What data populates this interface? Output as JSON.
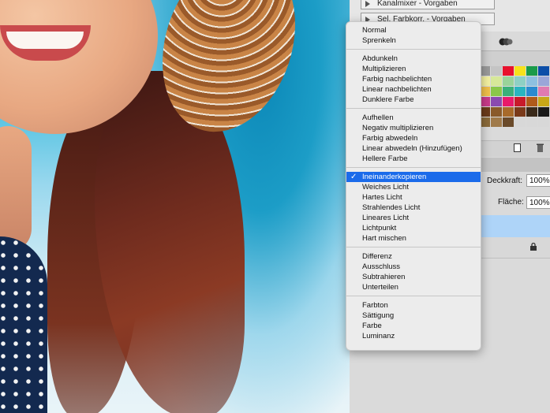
{
  "panel": {
    "adjustments": [
      "Kanalmixer - Vorgaben",
      "Sel. Farbkorr. - Vorgaben"
    ],
    "opacity_label": "Deckkraft:",
    "opacity_value": "100%",
    "fill_label": "Fläche:",
    "fill_value": "100%",
    "swatch_colors": [
      "#9a9a9a",
      "#c4c4c4",
      "#e8112d",
      "#f7e21a",
      "#1a9b4a",
      "#0c4ea8",
      "#f3f0a0",
      "#d7e89a",
      "#9ad39a",
      "#8ed0c4",
      "#8ec0e0",
      "#9aa6d8",
      "#f0c04a",
      "#8ac84a",
      "#3ab07a",
      "#2ab4c0",
      "#2a8ad0",
      "#e07ab0",
      "#c83a8a",
      "#8a4ab0",
      "#e81a6a",
      "#c81a2a",
      "#b05a1a",
      "#c8a818",
      "#6a3a1a",
      "#8a5a2a",
      "#a86a2a",
      "#7a3a1a",
      "#3a2a1a",
      "#1a1a1a",
      "#8a6a3a",
      "#a07a4a",
      "#6a4a2a",
      "#d8d8d8",
      "#d8d8d8",
      "#d8d8d8"
    ]
  },
  "menu": {
    "groups": [
      [
        "Normal",
        "Sprenkeln"
      ],
      [
        "Abdunkeln",
        "Multiplizieren",
        "Farbig nachbelichten",
        "Linear nachbelichten",
        "Dunklere Farbe"
      ],
      [
        "Aufhellen",
        "Negativ multiplizieren",
        "Farbig abwedeln",
        "Linear abwedeln (Hinzufügen)",
        "Hellere Farbe"
      ],
      [
        "Ineinanderkopieren",
        "Weiches Licht",
        "Hartes Licht",
        "Strahlendes Licht",
        "Lineares Licht",
        "Lichtpunkt",
        "Hart mischen"
      ],
      [
        "Differenz",
        "Ausschluss",
        "Subtrahieren",
        "Unterteilen"
      ],
      [
        "Farbton",
        "Sättigung",
        "Farbe",
        "Luminanz"
      ]
    ],
    "selected": "Ineinanderkopieren",
    "check_glyph": "✓"
  }
}
